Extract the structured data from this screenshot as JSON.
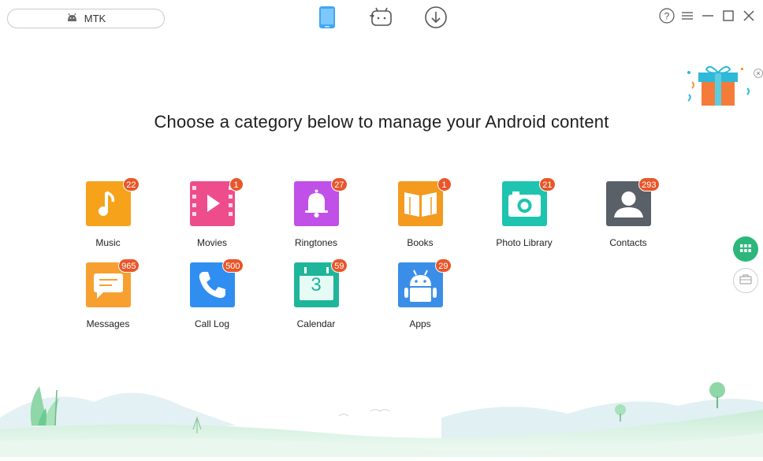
{
  "device": {
    "name": "MTK",
    "icon": "android-icon"
  },
  "topnav": {
    "items": [
      {
        "name": "device-manager-tab",
        "icon": "phone-icon",
        "active": true
      },
      {
        "name": "android-mirror-tab",
        "icon": "android-transfer-icon",
        "active": false
      },
      {
        "name": "downloader-tab",
        "icon": "download-icon",
        "active": false
      }
    ],
    "accent": "#3da8f5"
  },
  "window_controls": [
    "help-icon",
    "menu-icon",
    "minimize-icon",
    "maximize-icon",
    "close-icon"
  ],
  "headline": "Choose a category below to manage your Android content",
  "categories": [
    {
      "label": "Music",
      "count": "22",
      "icon": "music-note-icon",
      "color": "#f7a21b"
    },
    {
      "label": "Movies",
      "count": "1",
      "icon": "film-play-icon",
      "color": "#ee4d8c"
    },
    {
      "label": "Ringtones",
      "count": "27",
      "icon": "bell-icon",
      "color": "#c050e8"
    },
    {
      "label": "Books",
      "count": "1",
      "icon": "open-book-icon",
      "color": "#f39a1f"
    },
    {
      "label": "Photo Library",
      "count": "21",
      "icon": "camera-icon",
      "color": "#1ec4b0"
    },
    {
      "label": "Contacts",
      "count": "293",
      "icon": "person-silhouette-icon",
      "color": "#5a6068"
    },
    {
      "label": "Messages",
      "count": "965",
      "icon": "chat-bubble-icon",
      "color": "#f7a030"
    },
    {
      "label": "Call Log",
      "count": "500",
      "icon": "phone-handset-icon",
      "color": "#2f8ef0"
    },
    {
      "label": "Calendar",
      "count": "59",
      "icon": "calendar-icon",
      "color": "#1fb59a",
      "day": "3"
    },
    {
      "label": "Apps",
      "count": "29",
      "icon": "android-robot-icon",
      "color": "#3a8ee8"
    }
  ],
  "side_buttons": [
    {
      "name": "grid-view-icon",
      "active": true,
      "color": "#2cb77a"
    },
    {
      "name": "toolbox-icon",
      "active": false
    }
  ],
  "badge_color": "#e8572a"
}
